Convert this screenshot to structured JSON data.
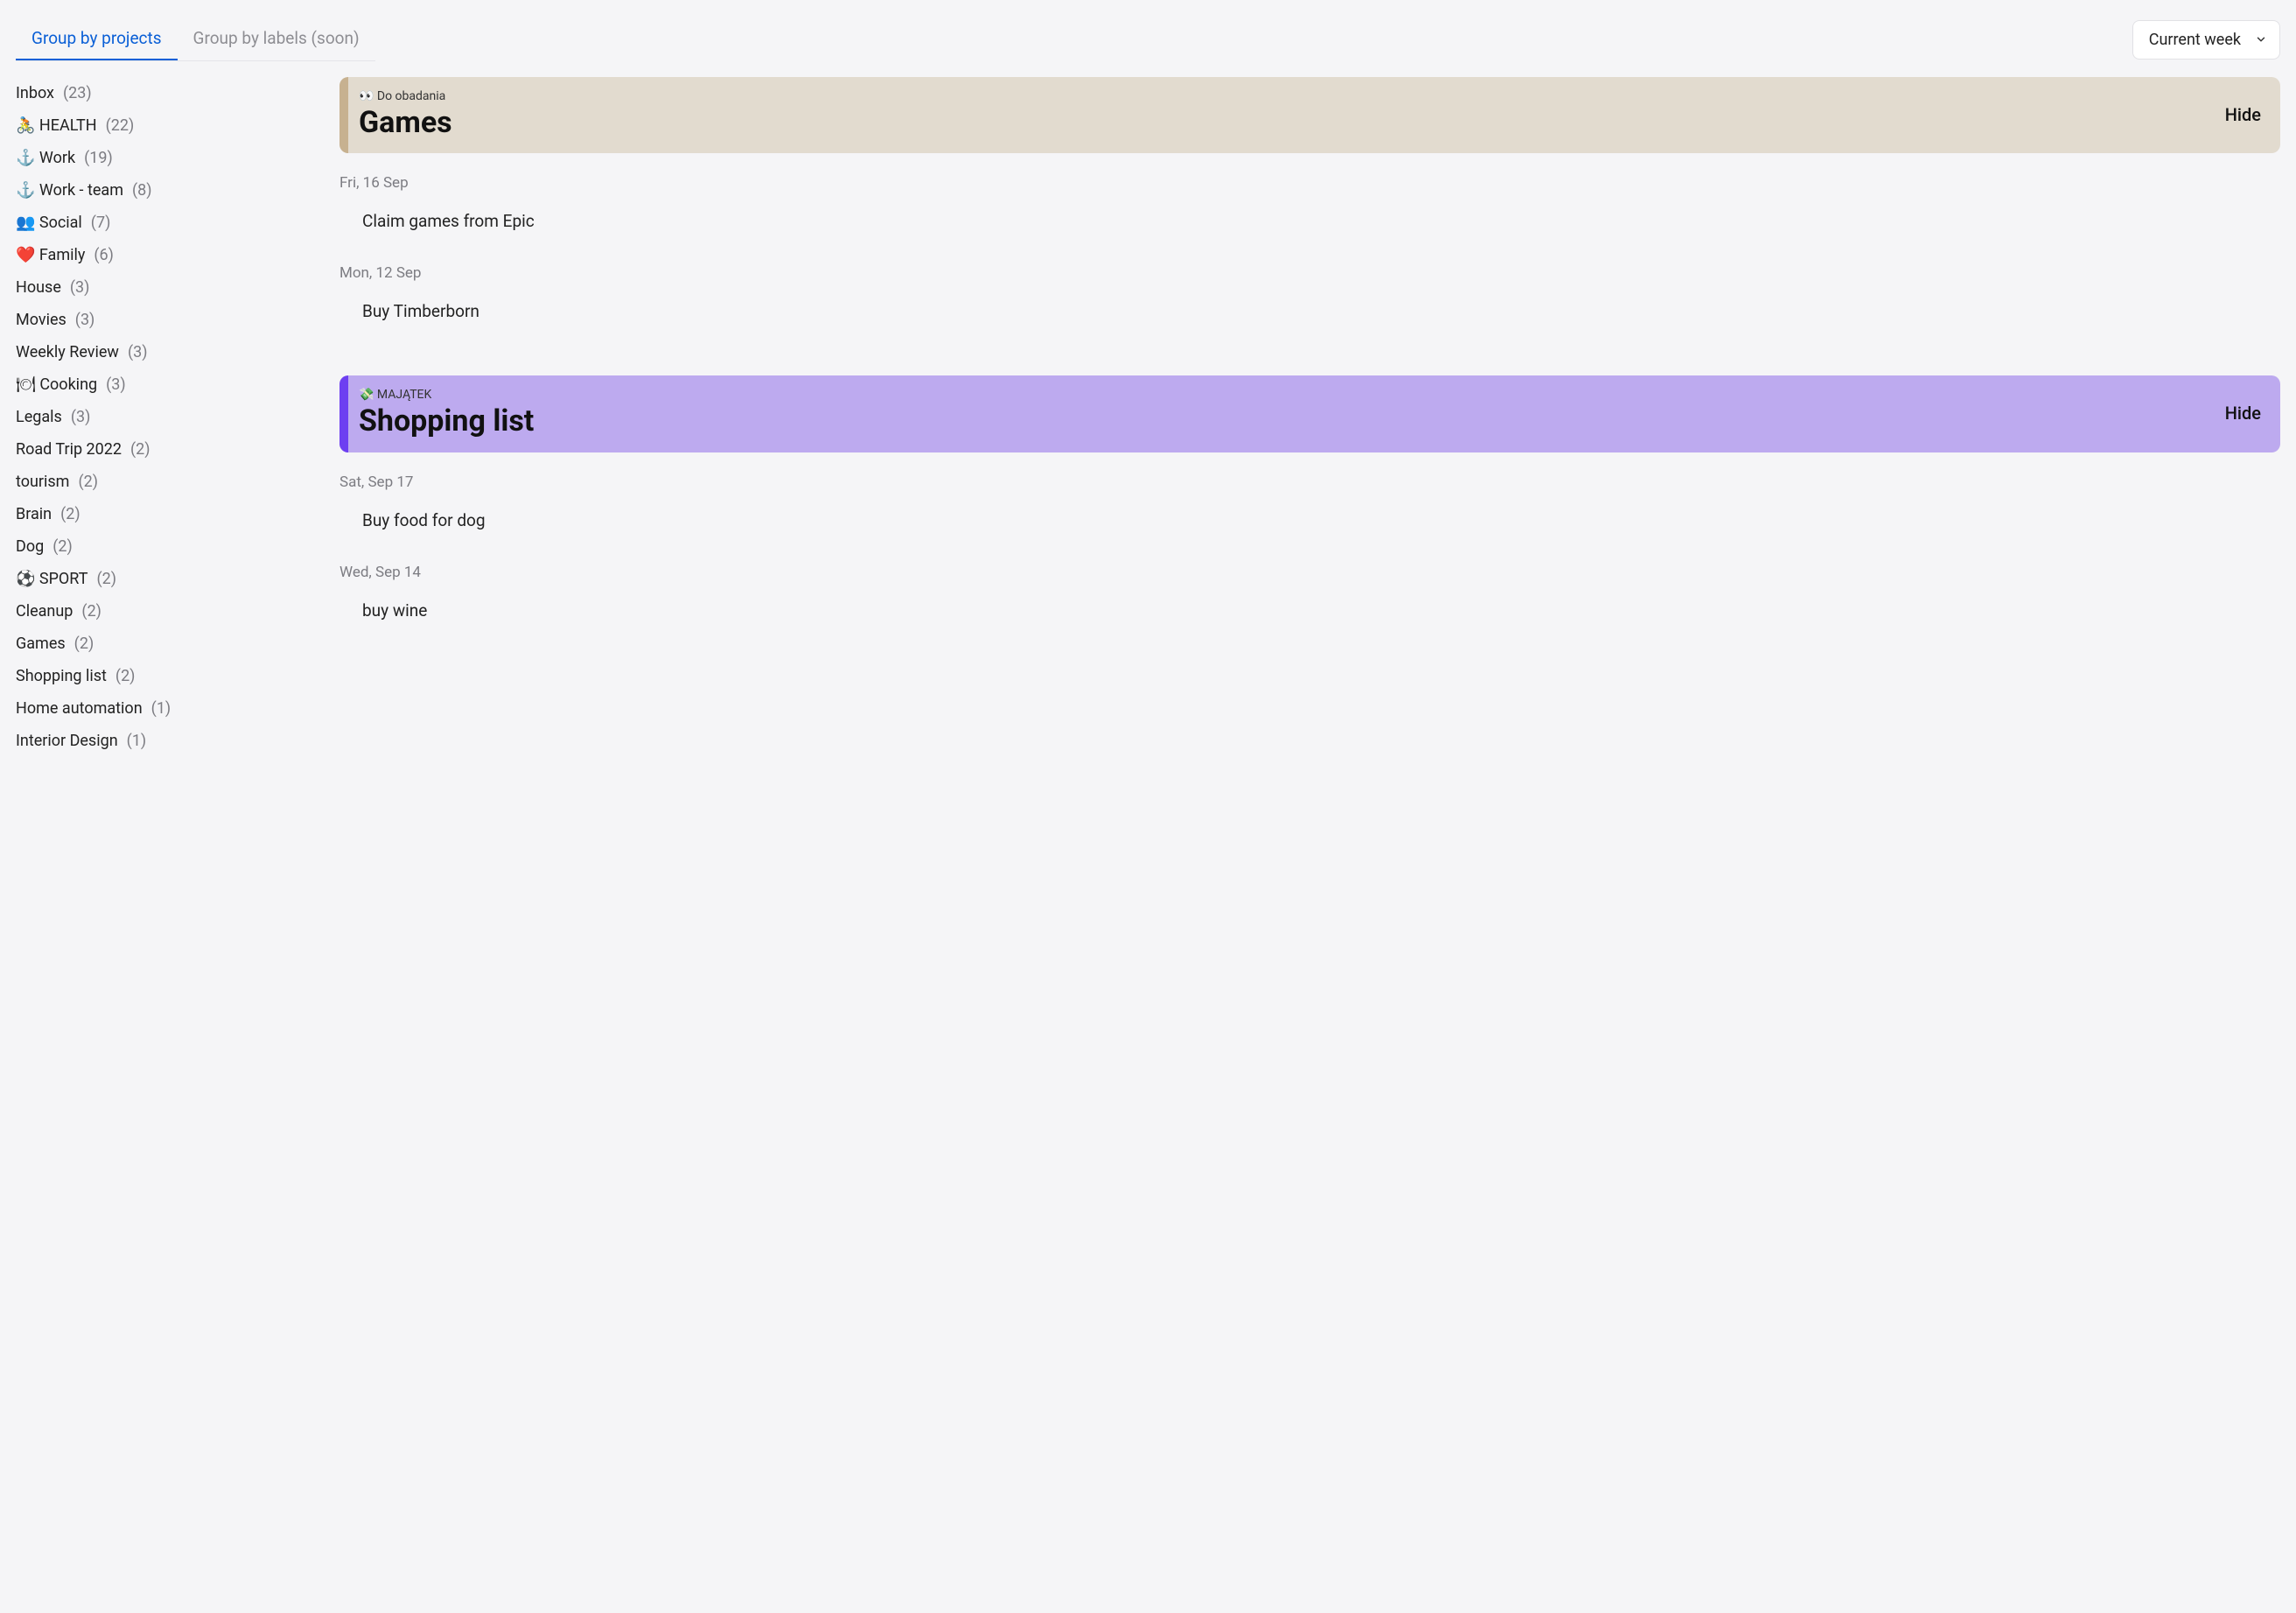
{
  "tabs": {
    "projects": "Group by projects",
    "labels": "Group by labels (soon)"
  },
  "filter": {
    "selected": "Current week"
  },
  "sidebar": [
    {
      "label": "Inbox",
      "count": "(23)"
    },
    {
      "label": "🚴 HEALTH",
      "count": "(22)"
    },
    {
      "label": "⚓ Work",
      "count": "(19)"
    },
    {
      "label": "⚓ Work - team",
      "count": "(8)"
    },
    {
      "label": "👥 Social",
      "count": "(7)"
    },
    {
      "label": "❤️ Family",
      "count": "(6)"
    },
    {
      "label": "House",
      "count": "(3)"
    },
    {
      "label": "Movies",
      "count": "(3)"
    },
    {
      "label": "Weekly Review",
      "count": "(3)"
    },
    {
      "label": "🍽 Cooking",
      "count": "(3)"
    },
    {
      "label": "Legals",
      "count": "(3)"
    },
    {
      "label": "Road Trip 2022",
      "count": "(2)"
    },
    {
      "label": "tourism",
      "count": "(2)"
    },
    {
      "label": "Brain",
      "count": "(2)"
    },
    {
      "label": "Dog",
      "count": "(2)"
    },
    {
      "label": "⚽ SPORT",
      "count": "(2)"
    },
    {
      "label": "Cleanup",
      "count": "(2)"
    },
    {
      "label": "Games",
      "count": "(2)"
    },
    {
      "label": "Shopping list",
      "count": "(2)"
    },
    {
      "label": "Home automation",
      "count": "(1)"
    },
    {
      "label": "Interior Design",
      "count": "(1)"
    }
  ],
  "sections": [
    {
      "meta": "👀 Do obadania",
      "title": "Games",
      "hide": "Hide",
      "variant": "beige",
      "groups": [
        {
          "date": "Fri, 16 Sep",
          "tasks": [
            "Claim games from Epic"
          ]
        },
        {
          "date": "Mon, 12 Sep",
          "tasks": [
            "Buy Timberborn"
          ]
        }
      ]
    },
    {
      "meta": "💸 MAJĄTEK",
      "title": "Shopping list",
      "hide": "Hide",
      "variant": "purple",
      "groups": [
        {
          "date": "Sat, Sep 17",
          "tasks": [
            "Buy food for dog"
          ]
        },
        {
          "date": "Wed, Sep 14",
          "tasks": [
            "buy wine"
          ]
        }
      ]
    }
  ]
}
